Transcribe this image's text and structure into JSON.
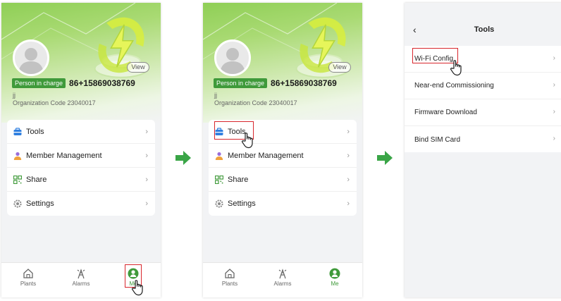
{
  "profile": {
    "view_label": "View",
    "role": "Person in charge",
    "phone": "86+15869038769",
    "name": "jj",
    "org_code": "Organization Code 23040017"
  },
  "menu": [
    {
      "label": "Tools",
      "icon": "toolbox-icon"
    },
    {
      "label": "Member Management",
      "icon": "person-icon"
    },
    {
      "label": "Share",
      "icon": "qr-code-icon"
    },
    {
      "label": "Settings",
      "icon": "gear-icon"
    }
  ],
  "tabs": [
    {
      "label": "Plants",
      "icon": "house-icon"
    },
    {
      "label": "Alarms",
      "icon": "alarm-tower-icon"
    },
    {
      "label": "Me",
      "icon": "user-circle-icon"
    }
  ],
  "tools_page": {
    "title": "Tools",
    "items": [
      "Wi-Fi Config",
      "Near-end Commissioning",
      "Firmware Download",
      "Bind SIM Card"
    ]
  },
  "colors": {
    "accent_green": "#3f9a3a",
    "highlight_red": "#d8262c",
    "arrow_green": "#3aa547"
  }
}
